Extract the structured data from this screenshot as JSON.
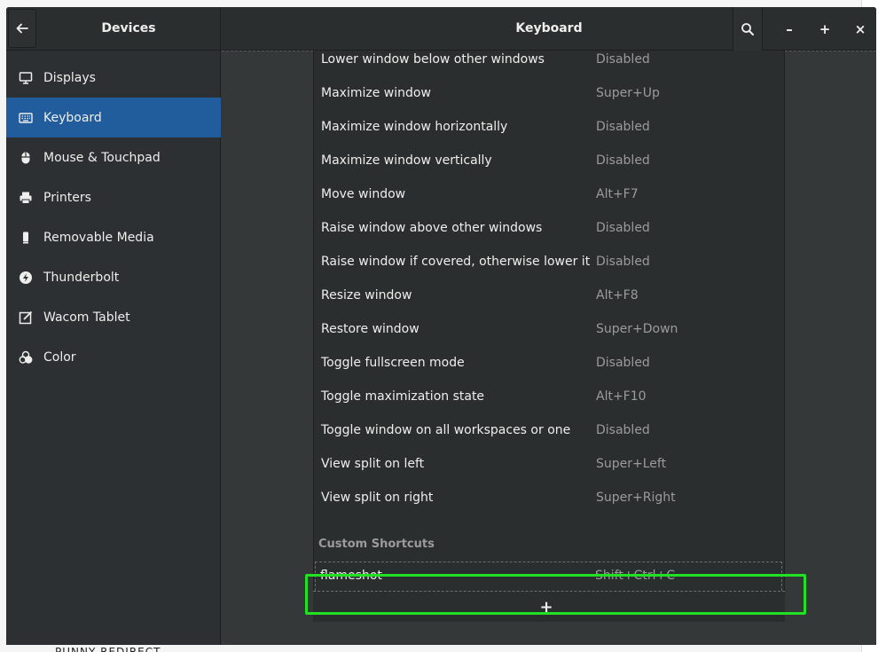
{
  "background": {
    "partial_text": "PUNNY REDIRECT"
  },
  "header": {
    "left_title": "Devices",
    "title": "Keyboard",
    "minimize": "–",
    "maximize": "+",
    "close": "×"
  },
  "sidebar": {
    "items": [
      {
        "label": "Displays",
        "icon": "display-icon",
        "active": false
      },
      {
        "label": "Keyboard",
        "icon": "keyboard-icon",
        "active": true
      },
      {
        "label": "Mouse & Touchpad",
        "icon": "mouse-icon",
        "active": false
      },
      {
        "label": "Printers",
        "icon": "printer-icon",
        "active": false
      },
      {
        "label": "Removable Media",
        "icon": "usb-drive-icon",
        "active": false
      },
      {
        "label": "Thunderbolt",
        "icon": "thunderbolt-icon",
        "active": false
      },
      {
        "label": "Wacom Tablet",
        "icon": "tablet-icon",
        "active": false
      },
      {
        "label": "Color",
        "icon": "color-icon",
        "active": false
      }
    ]
  },
  "shortcuts": {
    "rows": [
      {
        "name": "Lower window below other windows",
        "accel": "Disabled"
      },
      {
        "name": "Maximize window",
        "accel": "Super+Up"
      },
      {
        "name": "Maximize window horizontally",
        "accel": "Disabled"
      },
      {
        "name": "Maximize window vertically",
        "accel": "Disabled"
      },
      {
        "name": "Move window",
        "accel": "Alt+F7"
      },
      {
        "name": "Raise window above other windows",
        "accel": "Disabled"
      },
      {
        "name": "Raise window if covered, otherwise lower it",
        "accel": "Disabled"
      },
      {
        "name": "Resize window",
        "accel": "Alt+F8"
      },
      {
        "name": "Restore window",
        "accel": "Super+Down"
      },
      {
        "name": "Toggle fullscreen mode",
        "accel": "Disabled"
      },
      {
        "name": "Toggle maximization state",
        "accel": "Alt+F10"
      },
      {
        "name": "Toggle window on all workspaces or one",
        "accel": "Disabled"
      },
      {
        "name": "View split on left",
        "accel": "Super+Left"
      },
      {
        "name": "View split on right",
        "accel": "Super+Right"
      }
    ],
    "custom_section_title": "Custom Shortcuts",
    "custom_rows": [
      {
        "name": "flameshot",
        "accel": "Shift+Ctrl+C"
      }
    ],
    "add_label": "+"
  },
  "colors": {
    "accent": "#215d9c",
    "highlight": "#22e022"
  }
}
